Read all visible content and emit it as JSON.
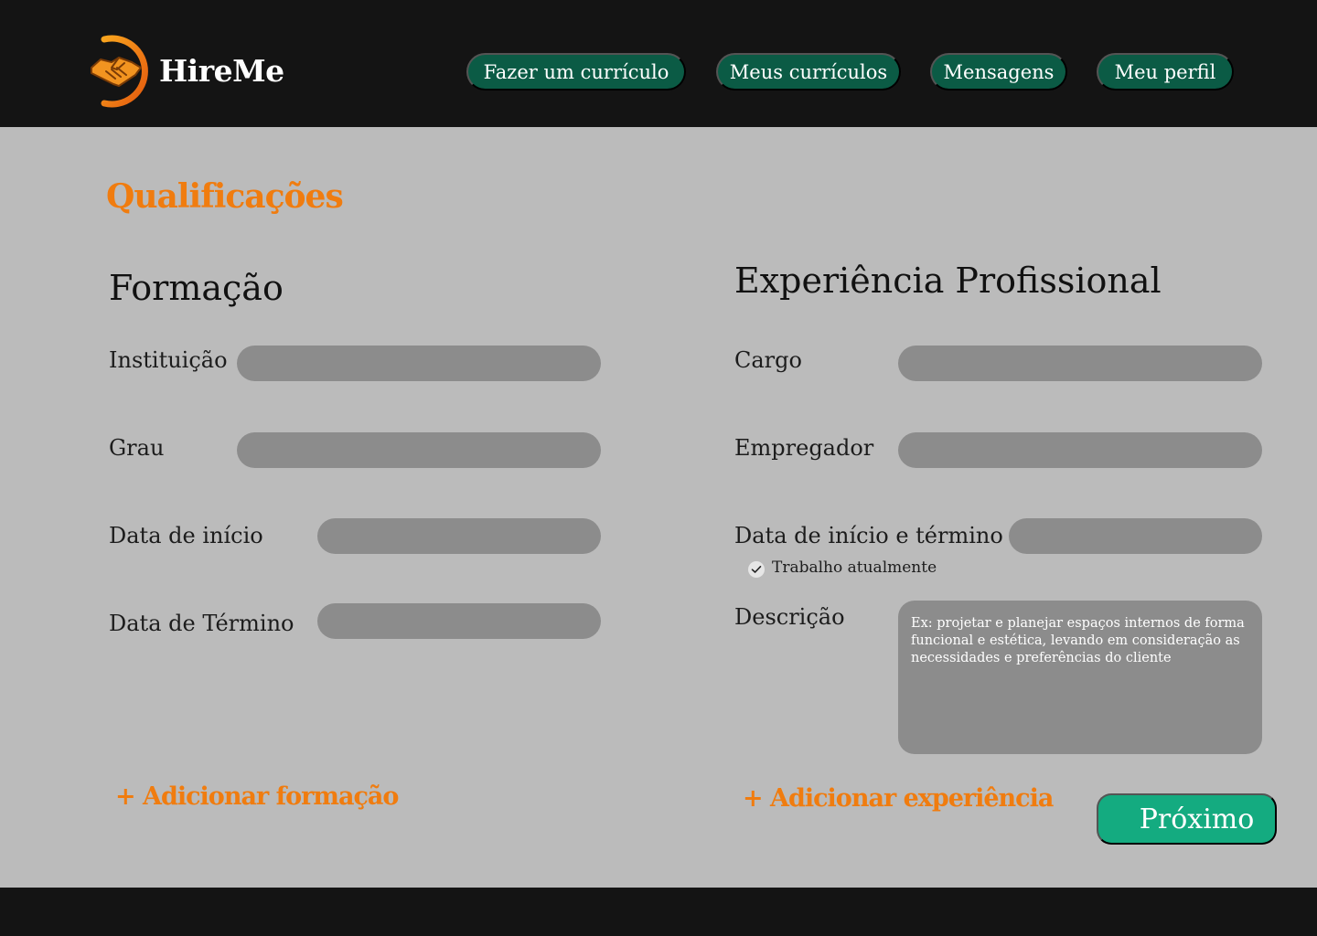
{
  "header": {
    "brand": "HireMe",
    "logo_icon": "handshake-icon",
    "nav": [
      {
        "label": "Fazer um currículo"
      },
      {
        "label": "Meus currículos"
      },
      {
        "label": "Mensagens"
      },
      {
        "label": "Meu perfil"
      }
    ]
  },
  "page": {
    "title": "Qualificações"
  },
  "education": {
    "title": "Formação",
    "fields": [
      {
        "label": "Instituição",
        "value": ""
      },
      {
        "label": "Grau",
        "value": ""
      },
      {
        "label": "Data de início",
        "value": ""
      },
      {
        "label": "Data de Término",
        "value": ""
      }
    ],
    "add_label": "+ Adicionar formação"
  },
  "experience": {
    "title": "Experiência Profissional",
    "fields": [
      {
        "label": "Cargo",
        "value": ""
      },
      {
        "label": "Empregador",
        "value": ""
      },
      {
        "label": "Data de início e término",
        "value": ""
      }
    ],
    "current_job_label": "Trabalho atualmente",
    "current_job_checked": true,
    "description_label": "Descrição",
    "description_placeholder": "Ex: projetar e planejar espaços internos de forma funcional e estética, levando em consideração as necessidades e preferências do cliente",
    "add_label": "+ Adicionar experiência"
  },
  "actions": {
    "next_label": "Próximo"
  },
  "colors": {
    "accent_orange": "#f07c0f",
    "nav_green": "#0b5b45",
    "next_green": "#14ab80",
    "field_gray": "#8c8c8c",
    "background_gray": "#bbbbbb",
    "header_dark": "#141414"
  }
}
